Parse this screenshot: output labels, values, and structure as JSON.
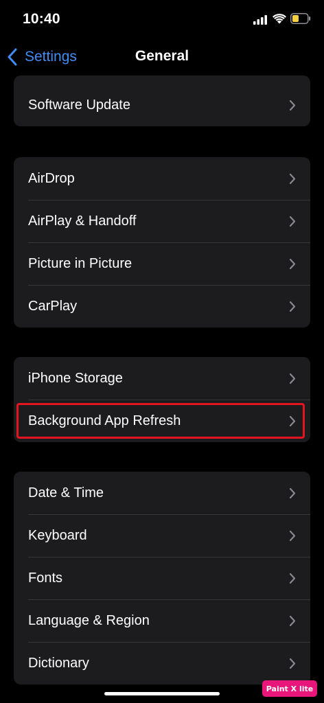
{
  "status_bar": {
    "time": "10:40",
    "battery_color": "#f5d142"
  },
  "nav": {
    "back_label": "Settings",
    "title": "General",
    "accent_color": "#3f8ef6"
  },
  "groups": [
    {
      "items": [
        {
          "label": "Software Update"
        }
      ]
    },
    {
      "items": [
        {
          "label": "AirDrop"
        },
        {
          "label": "AirPlay & Handoff"
        },
        {
          "label": "Picture in Picture"
        },
        {
          "label": "CarPlay"
        }
      ]
    },
    {
      "items": [
        {
          "label": "iPhone Storage"
        },
        {
          "label": "Background App Refresh",
          "highlighted": true
        }
      ]
    },
    {
      "items": [
        {
          "label": "Date & Time"
        },
        {
          "label": "Keyboard"
        },
        {
          "label": "Fonts"
        },
        {
          "label": "Language & Region"
        },
        {
          "label": "Dictionary"
        }
      ]
    }
  ],
  "highlight_color": "#e6141e",
  "watermark": {
    "text": "Paint X lite",
    "color": "#e8157a"
  }
}
